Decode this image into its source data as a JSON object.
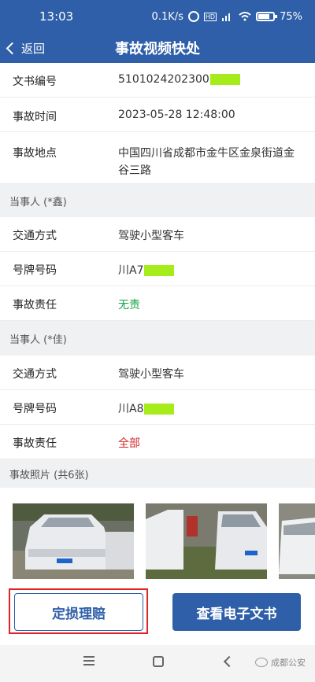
{
  "status_bar": {
    "time": "13:03",
    "network_speed": "0.1K/s",
    "battery": "75%"
  },
  "nav": {
    "back_label": "返回",
    "title": "事故视频快处"
  },
  "case_info": {
    "doc_number_label": "文书编号",
    "doc_number_value": "5101024202300",
    "time_label": "事故时间",
    "time_value": "2023-05-28 12:48:00",
    "location_label": "事故地点",
    "location_line1": "中国四川省成都市金牛区金泉街道金",
    "location_line2": "谷三路"
  },
  "party1": {
    "header": "当事人 (*鑫)",
    "transport_label": "交通方式",
    "transport_value": "驾驶小型客车",
    "plate_label": "号牌号码",
    "plate_value": "川A7",
    "liability_label": "事故责任",
    "liability_value": "无责",
    "liability_color": "#19a34a"
  },
  "party2": {
    "header": "当事人 (*佳)",
    "transport_label": "交通方式",
    "transport_value": "驾驶小型客车",
    "plate_label": "号牌号码",
    "plate_value": "川A8",
    "liability_label": "事故责任",
    "liability_value": "全部",
    "liability_color": "#d62a2a"
  },
  "photos": {
    "header": "事故照片 (共6张)"
  },
  "actions": {
    "damage_claim_label": "定损理赔",
    "view_doc_label": "查看电子文书"
  },
  "watermark": {
    "text": "成都公安"
  },
  "colors": {
    "brand": "#2f5fa8",
    "mask": "#a6ec1a",
    "highlight": "#e02424"
  }
}
